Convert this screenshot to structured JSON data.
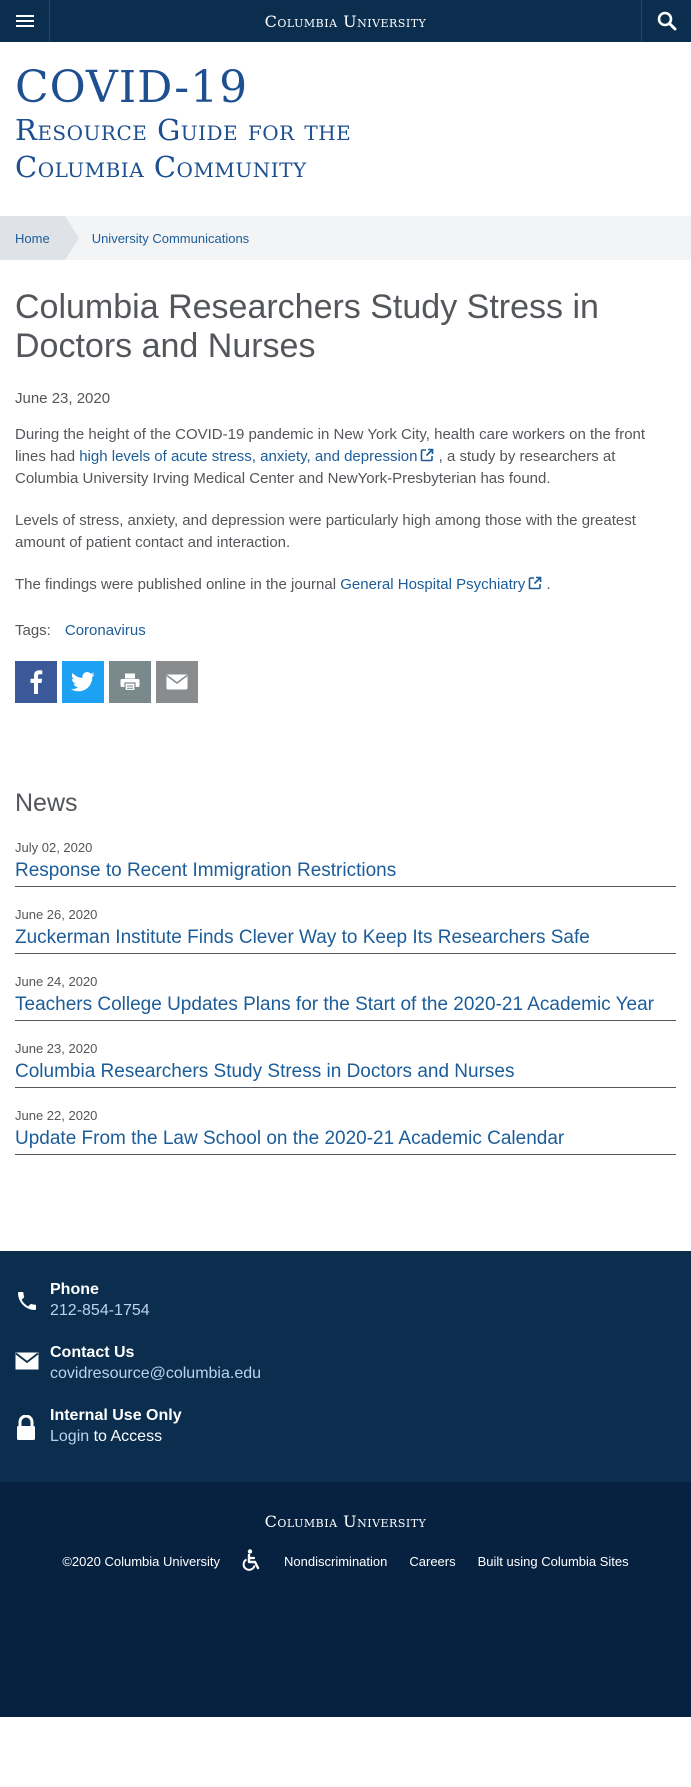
{
  "topbar": {
    "brand": "Columbia University",
    "menu_icon": "hamburger-menu-icon",
    "search_icon": "search-icon"
  },
  "site_header": {
    "title_line1": "COVID-19",
    "title_line2": "Resource Guide for the",
    "title_line3": "Columbia Community"
  },
  "breadcrumb": {
    "home": "Home",
    "current": "University Communications"
  },
  "article": {
    "title": "Columbia Researchers Study Stress in Doctors and Nurses",
    "date": "June 23, 2020",
    "p1_before": "During the height of the COVID-19 pandemic in New York City, health care workers on the front lines had ",
    "p1_link": "high levels of acute stress, anxiety, and depression",
    "p1_after": " , a study by researchers at Columbia University Irving Medical Center and NewYork-Presbyterian has found.",
    "p2": "Levels of stress, anxiety, and depression were particularly high among those with the greatest amount of patient contact and interaction.",
    "p3_before": "The findings were published online in the journal ",
    "p3_link": "General Hospital Psychiatry",
    "p3_after": " .",
    "tags_label": "Tags:",
    "tag": "Coronavirus"
  },
  "share": {
    "facebook_icon": "facebook-icon",
    "twitter_icon": "twitter-icon",
    "print_icon": "print-icon",
    "email_icon": "email-icon"
  },
  "news": {
    "heading": "News",
    "items": [
      {
        "date": "July 02, 2020",
        "title": "Response to Recent Immigration Restrictions"
      },
      {
        "date": "June 26, 2020",
        "title": "Zuckerman Institute Finds Clever Way to Keep Its Researchers Safe"
      },
      {
        "date": "June 24, 2020",
        "title": "Teachers College Updates Plans for the Start of the 2020-21 Academic Year"
      },
      {
        "date": "June 23, 2020",
        "title": "Columbia Researchers Study Stress in Doctors and Nurses"
      },
      {
        "date": "June 22, 2020",
        "title": "Update From the Law School on the 2020-21 Academic Calendar"
      }
    ]
  },
  "contact": {
    "phone_label": "Phone",
    "phone_value": "212-854-1754",
    "contact_label": "Contact Us",
    "contact_value": "covidresource@columbia.edu",
    "internal_label": "Internal Use Only",
    "login_link": "Login",
    "login_suffix": " to Access"
  },
  "footer": {
    "brand": "Columbia University",
    "copyright": "©2020 Columbia University",
    "accessibility_icon": "accessibility-icon",
    "nondiscrimination": "Nondiscrimination",
    "careers": "Careers",
    "built_using": "Built using Columbia Sites"
  },
  "colors": {
    "navy": "#0b2d4e",
    "footer_navy": "#062240",
    "link_blue": "#1c5d99",
    "title_blue": "#1d4f91",
    "facebook": "#3b5998",
    "twitter": "#1da1f2"
  }
}
